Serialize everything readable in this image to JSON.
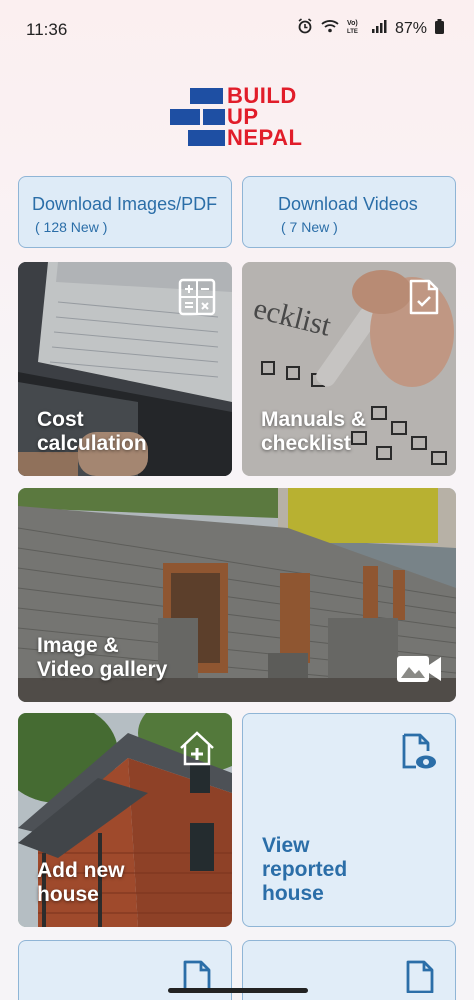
{
  "status_bar": {
    "time": "11:36",
    "battery": "87%",
    "icons": [
      "alarm-icon",
      "wifi-icon",
      "volte-icon",
      "signal-icon",
      "battery-icon"
    ]
  },
  "logo": {
    "lines": [
      "BUILD",
      "UP",
      "NEPAL"
    ],
    "colors": {
      "brick_blue": "#1e4fa3",
      "text_red": "#e11d2a"
    }
  },
  "downloads": {
    "images": {
      "title": "Download Images/PDF",
      "subtitle": "( 128 New )"
    },
    "videos": {
      "title": "Download Videos",
      "subtitle": "( 7 New )"
    }
  },
  "cards": {
    "cost": {
      "label_line1": "Cost",
      "label_line2": "calculation",
      "icon": "calculator-icon"
    },
    "manuals": {
      "label_line1": "Manuals &",
      "label_line2": "checklist",
      "icon": "document-check-icon"
    },
    "gallery": {
      "label_line1": "Image &",
      "label_line2": "Video gallery",
      "icon": "video-camera-icon"
    },
    "add_house": {
      "label_line1": "Add new",
      "label_line2": "house",
      "icon": "house-plus-icon"
    },
    "view_reported": {
      "label_line1": "View",
      "label_line2": "reported",
      "label_line3": "house",
      "icon": "document-view-icon"
    }
  },
  "colors": {
    "accent": "#2b6ea8",
    "card_light": "#e1edf8",
    "border": "#8fb5d6"
  }
}
